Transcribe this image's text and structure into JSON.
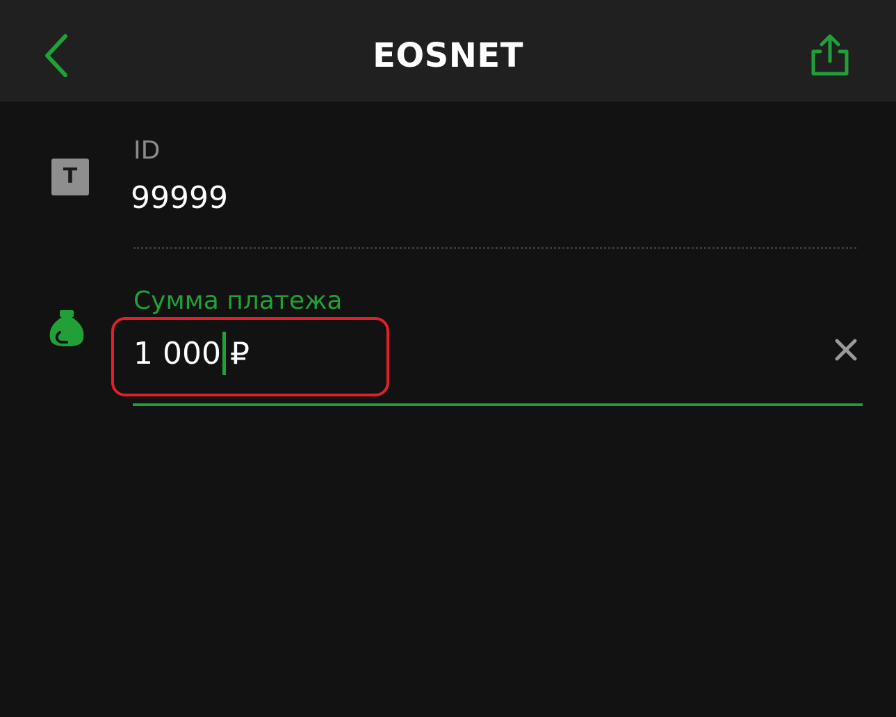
{
  "header": {
    "title": "EOSNET",
    "back_icon": "chevron-left-icon",
    "share_icon": "share-icon"
  },
  "fields": {
    "id": {
      "icon": "text-field-icon",
      "icon_glyph": "T",
      "label": "ID",
      "value": "99999"
    },
    "amount": {
      "icon": "money-bag-icon",
      "label": "Сумма платежа",
      "value": "1 000",
      "currency": "₽",
      "clear_icon": "close-icon"
    }
  },
  "colors": {
    "accent": "#21a038",
    "highlight": "#e3202a",
    "background": "#121212",
    "header_background": "#202020"
  }
}
